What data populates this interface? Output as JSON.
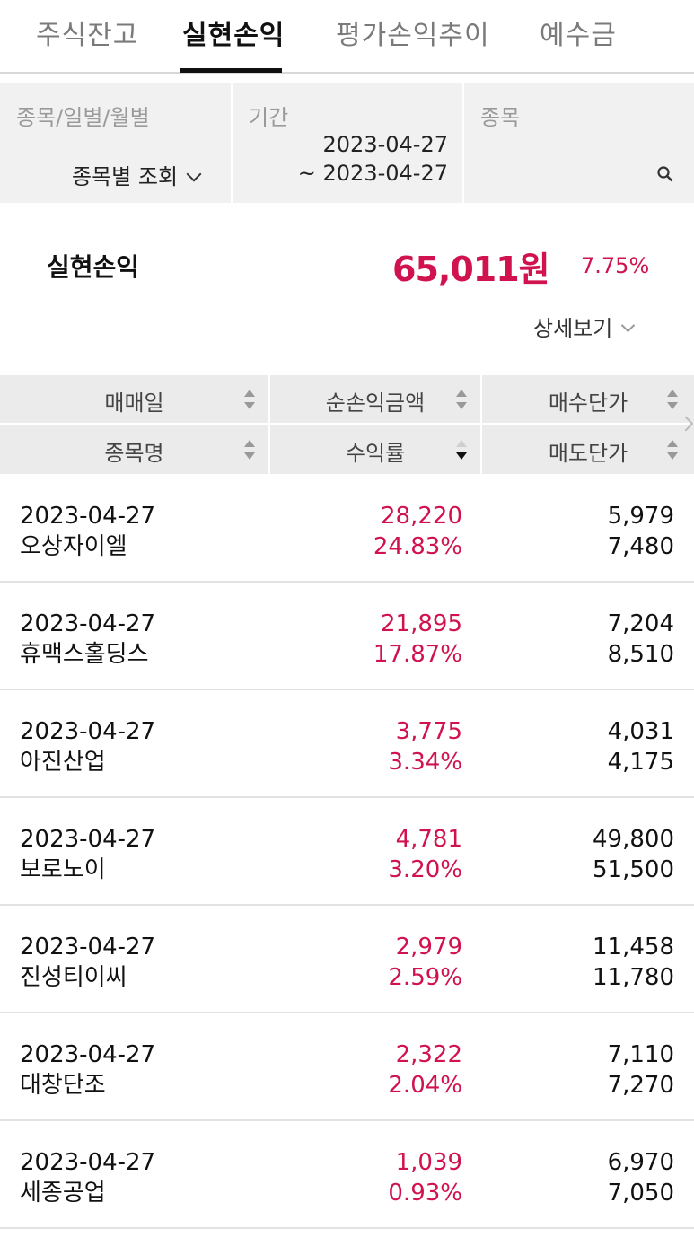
{
  "tabs": [
    {
      "label": "주식잔고"
    },
    {
      "label": "실현손익"
    },
    {
      "label": "평가손익추이"
    },
    {
      "label": "예수금"
    }
  ],
  "active_tab": 1,
  "filter": {
    "type_label": "종목/일별/월별",
    "type_value": "종목별 조회",
    "period_label": "기간",
    "period_start": "2023-04-27",
    "period_end": "~ 2023-04-27",
    "stock_label": "종목",
    "stock_value": ""
  },
  "summary": {
    "label": "실현손익",
    "amount": "65,011원",
    "rate": "7.75%",
    "detail_label": "상세보기"
  },
  "table": {
    "headers": {
      "trade_date": "매매일",
      "net_profit": "순손익금액",
      "buy_price": "매수단가",
      "stock_name": "종목명",
      "return_rate": "수익률",
      "sell_price": "매도단가"
    },
    "active_sort": "return_rate-desc",
    "rows": [
      {
        "date": "2023-04-27",
        "name": "오상자이엘",
        "profit": "28,220",
        "rate": "24.83%",
        "buy": "5,979",
        "sell": "7,480"
      },
      {
        "date": "2023-04-27",
        "name": "휴맥스홀딩스",
        "profit": "21,895",
        "rate": "17.87%",
        "buy": "7,204",
        "sell": "8,510"
      },
      {
        "date": "2023-04-27",
        "name": "아진산업",
        "profit": "3,775",
        "rate": "3.34%",
        "buy": "4,031",
        "sell": "4,175"
      },
      {
        "date": "2023-04-27",
        "name": "보로노이",
        "profit": "4,781",
        "rate": "3.20%",
        "buy": "49,800",
        "sell": "51,500"
      },
      {
        "date": "2023-04-27",
        "name": "진성티이씨",
        "profit": "2,979",
        "rate": "2.59%",
        "buy": "11,458",
        "sell": "11,780"
      },
      {
        "date": "2023-04-27",
        "name": "대창단조",
        "profit": "2,322",
        "rate": "2.04%",
        "buy": "7,110",
        "sell": "7,270"
      },
      {
        "date": "2023-04-27",
        "name": "세종공업",
        "profit": "1,039",
        "rate": "0.93%",
        "buy": "6,970",
        "sell": "7,050"
      }
    ]
  },
  "colors": {
    "accent_red": "#d0134f",
    "header_bg": "#ebebeb",
    "filter_bg": "#f1f1f1"
  }
}
